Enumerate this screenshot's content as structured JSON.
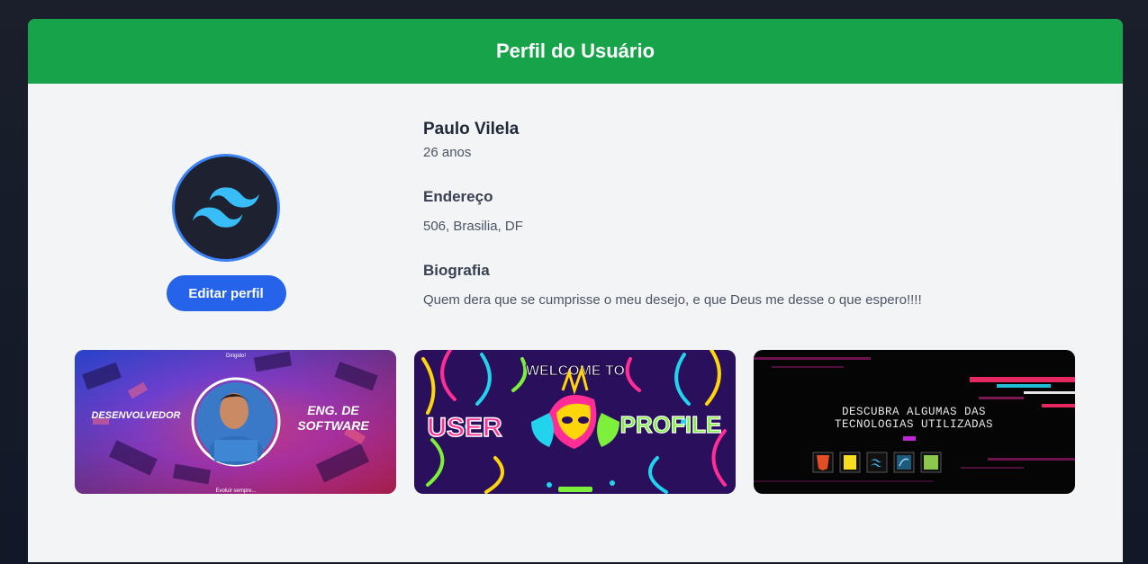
{
  "header": {
    "title": "Perfil do Usuário"
  },
  "profile": {
    "name": "Paulo Vilela",
    "age": "26 anos",
    "address_label": "Endereço",
    "address": "506, Brasilia, DF",
    "bio_label": "Biografia",
    "bio": "Quem dera que se cumprisse o meu desejo, e que Deus me desse o que espero!!!!",
    "edit_button": "Editar perfil"
  },
  "banners": [
    {
      "name": "developer-banner",
      "top_caption": "Dirigido!",
      "left_text": "DESENVOLVEDOR",
      "right_text_1": "ENG. DE",
      "right_text_2": "SOFTWARE",
      "bottom_caption": "Evoluir sempre..."
    },
    {
      "name": "welcome-banner",
      "title": "WELCOME TO",
      "left_word": "USER",
      "right_word": "PROFILE"
    },
    {
      "name": "technologies-banner",
      "line1": "DESCUBRA ALGUMAS DAS",
      "line2": "TECNOLOGIAS UTILIZADAS",
      "tech_icons": [
        "html5-icon",
        "javascript-icon",
        "tailwind-icon",
        "mysql-icon",
        "nodejs-icon"
      ]
    }
  ],
  "colors": {
    "header": "#16a34a",
    "button": "#2563eb",
    "avatar_ring": "#3b82f6",
    "tailwind": "#38bdf8"
  }
}
